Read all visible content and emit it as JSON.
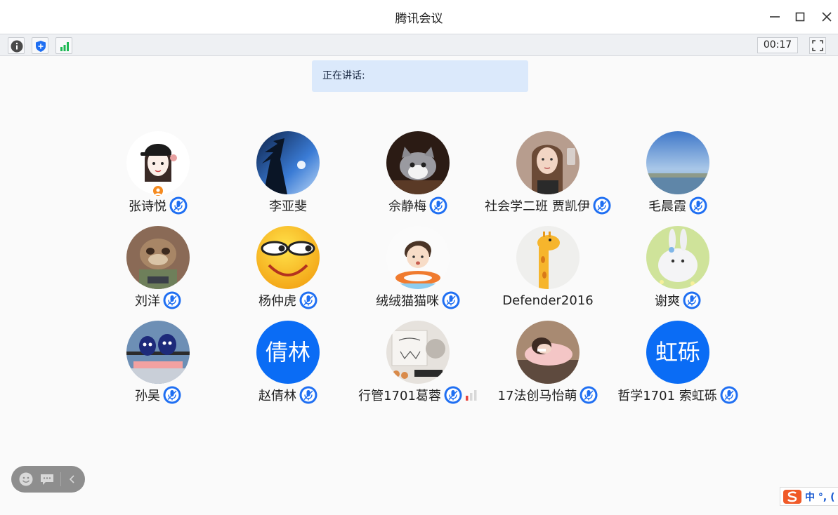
{
  "window": {
    "title": "腾讯会议"
  },
  "toolbar": {
    "timer": "00:17"
  },
  "speaking": {
    "label": "正在讲话:"
  },
  "participants": [
    {
      "name": "张诗悦",
      "avatar": "cartoon-girl-cap",
      "host": true
    },
    {
      "name": "李亚斐",
      "avatar": "tree-sky-photo"
    },
    {
      "name": "佘静梅",
      "avatar": "kitten-photo"
    },
    {
      "name": "社会学二班 贾凯伊",
      "avatar": "woman-portrait-photo"
    },
    {
      "name": "毛晨霞",
      "avatar": "lake-landscape-photo"
    },
    {
      "name": "刘洋",
      "avatar": "sloth-cartoon"
    },
    {
      "name": "杨仲虎",
      "avatar": "smiley-face-emoji"
    },
    {
      "name": "绒绒猫猫咪",
      "avatar": "cartoon-boy-swim-ring"
    },
    {
      "name": "Defender2016",
      "avatar": "giraffe-cartoon"
    },
    {
      "name": "谢爽",
      "avatar": "white-rabbit-photo"
    },
    {
      "name": "孙吴",
      "avatar": "blue-toy-figures-photo"
    },
    {
      "name": "赵倩林",
      "avatar_text": "倩林",
      "avatar_color": "#0a6cf5"
    },
    {
      "name": "行管1701葛蓉",
      "avatar": "sketch-drawing-photo",
      "signal": "weak"
    },
    {
      "name": "17法创马怡萌",
      "avatar": "sleeping-girl-photo"
    },
    {
      "name": "哲学1701 索虹砾",
      "avatar_text": "虹砾",
      "avatar_color": "#0a6cf5"
    }
  ],
  "taskbar": {
    "ime_label": "中 °, ("
  },
  "colors": {
    "accent": "#0a6cf5",
    "speaking_bg": "#dbe9fb",
    "mic_blue": "#1f6ff2",
    "host_orange": "#f58a1f"
  }
}
